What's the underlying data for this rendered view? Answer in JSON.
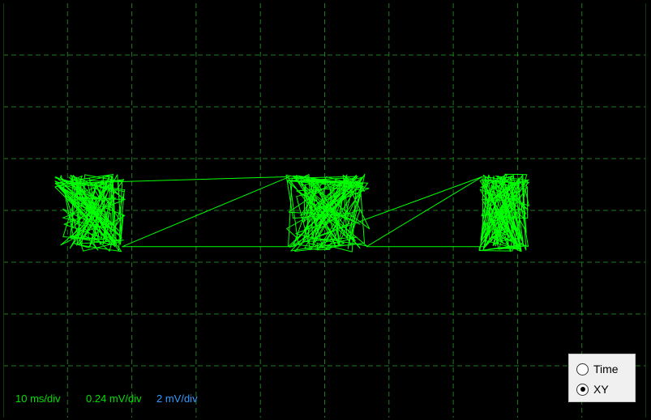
{
  "display": {
    "background": "#000000",
    "grid_color": "#1f7a1f",
    "trace_color": "#00ff00",
    "grid": {
      "horizontal_divisions": 10,
      "vertical_divisions": 8
    }
  },
  "status": {
    "timebase": {
      "label": "10 ms/div",
      "color": "#00e000"
    },
    "ch1_scale": {
      "label": "0.24 mV/div",
      "color": "#00e000"
    },
    "ch2_scale": {
      "label": "2 mV/div",
      "color": "#3399ff"
    }
  },
  "mode": {
    "options": [
      {
        "label": "Time",
        "selected": false
      },
      {
        "label": "XY",
        "selected": true
      }
    ]
  },
  "chart_data": {
    "type": "scatter",
    "plot_mode": "XY",
    "x_div_range": [
      -5,
      5
    ],
    "y_div_range": [
      -4,
      4
    ],
    "grid": true,
    "trace": {
      "color": "#00ff00",
      "clusters": [
        {
          "x_div": [
            -4.2,
            -3.1
          ],
          "y_div": [
            -0.8,
            0.7
          ]
        },
        {
          "x_div": [
            -0.6,
            0.7
          ],
          "y_div": [
            -0.8,
            0.7
          ]
        },
        {
          "x_div": [
            2.4,
            3.2
          ],
          "y_div": [
            -0.8,
            0.7
          ]
        }
      ]
    }
  }
}
